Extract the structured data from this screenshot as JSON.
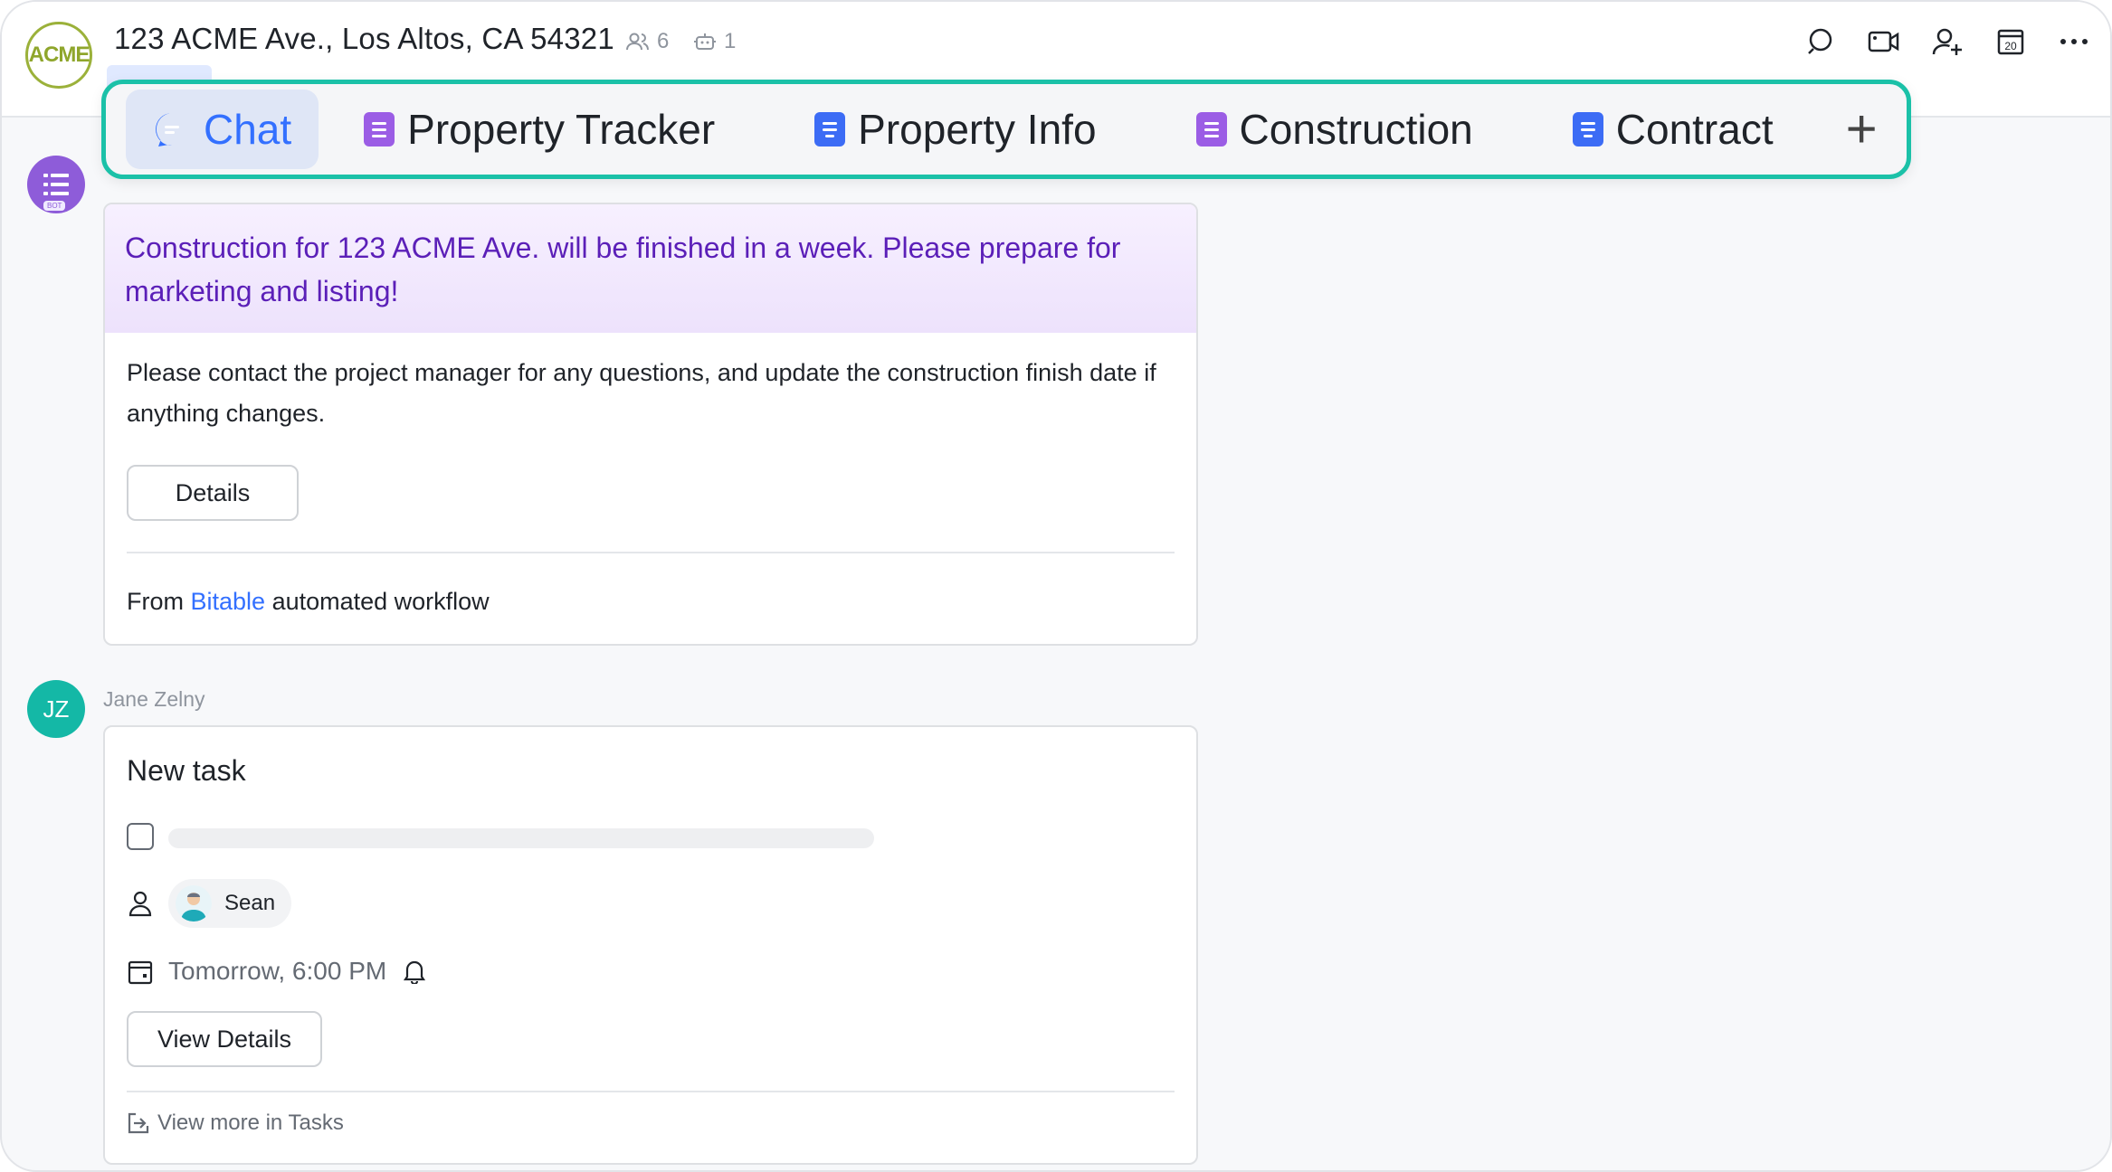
{
  "header": {
    "logo_text": "ACME",
    "title": "123 ACME Ave., Los Altos, CA 54321",
    "member_count": "6",
    "bot_count": "1"
  },
  "header_actions": [
    "search-icon",
    "video-call-icon",
    "add-member-icon",
    "calendar-icon",
    "more-icon"
  ],
  "calendar_day": "20",
  "tabs": [
    {
      "label": "Chat",
      "icon": "chat-bubble-icon",
      "active": true
    },
    {
      "label": "Property Tracker",
      "icon": "bitable-icon"
    },
    {
      "label": "Property Info",
      "icon": "doc-icon"
    },
    {
      "label": "Construction",
      "icon": "bitable-icon"
    },
    {
      "label": "Contract",
      "icon": "doc-icon"
    }
  ],
  "add_tab_label": "+",
  "bot_message": {
    "avatar_tag": "BOT",
    "headline": "Construction for 123 ACME Ave. will be finished in a week. Please prepare for marketing and listing!",
    "body": "Please contact the project manager for any questions, and update the construction finish date if anything changes.",
    "details_button": "Details",
    "footer_prefix": "From ",
    "footer_link": "Bitable",
    "footer_suffix": " automated workflow"
  },
  "task_message": {
    "sender_initials": "JZ",
    "sender_name": "Jane Zelny",
    "card_title": "New task",
    "assignee": "Sean",
    "due": "Tomorrow, 6:00 PM",
    "view_details_button": "View Details",
    "view_more_link": "View more in Tasks"
  },
  "colors": {
    "accent": "#3370ff",
    "callout_border": "#1bc1a8",
    "bot_headline": "#5b1fb8",
    "bot_avatar": "#8e5cd9",
    "jz_avatar": "#14b8a6"
  }
}
